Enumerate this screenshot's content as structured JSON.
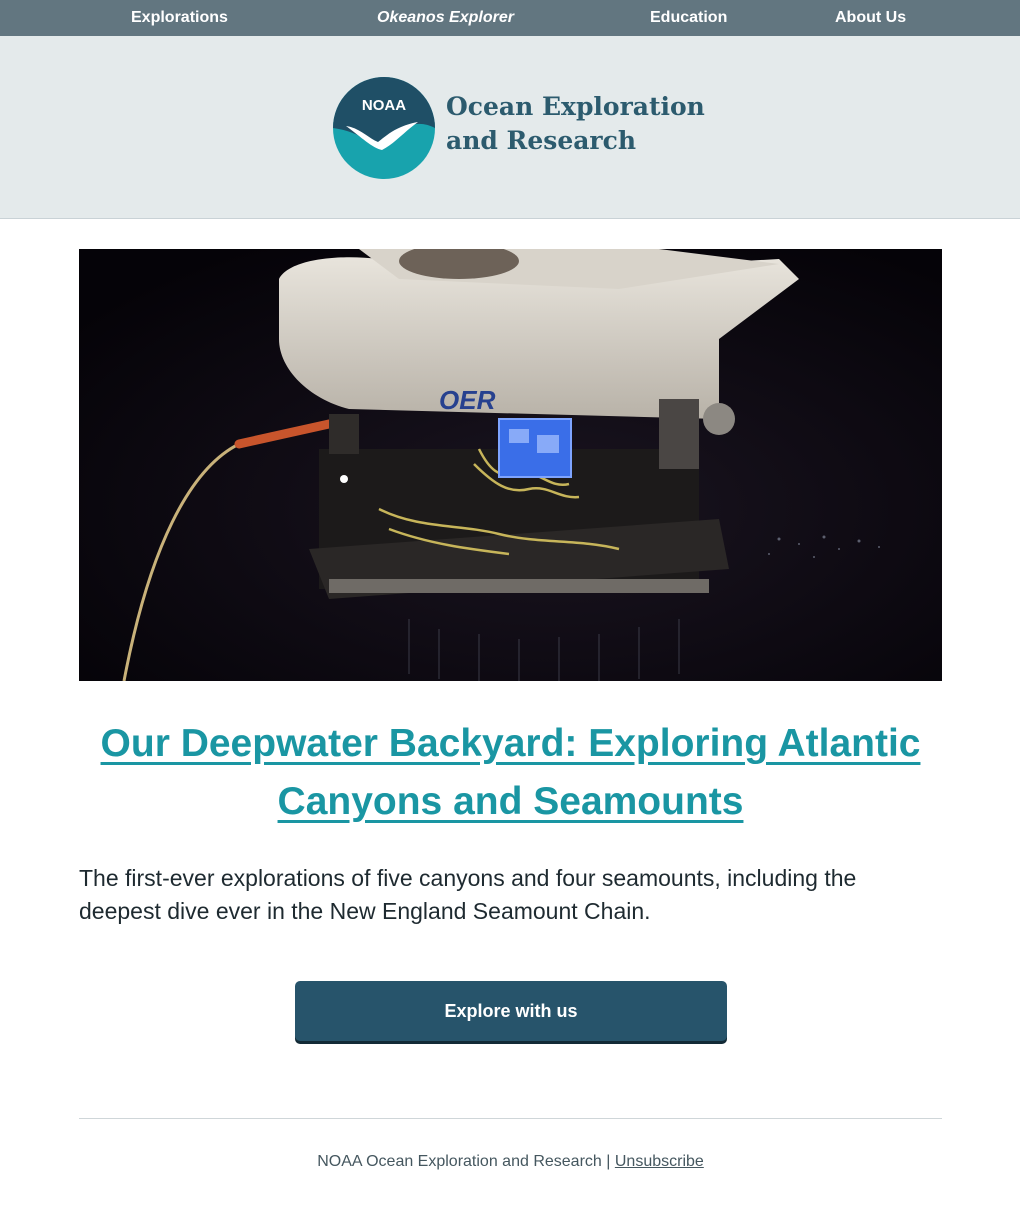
{
  "nav": {
    "items": [
      {
        "label": "Explorations"
      },
      {
        "label": "Okeanos Explorer"
      },
      {
        "label": "Education"
      },
      {
        "label": "About Us"
      }
    ]
  },
  "brand": {
    "logo_text": "NOAA",
    "name_line1": "Ocean Exploration",
    "name_line2": "and Research"
  },
  "hero": {
    "logo_text": "OER"
  },
  "article": {
    "title": "Our Deepwater Backyard: Exploring Atlantic Canyons and Seamounts",
    "summary": "The first-ever explorations of five canyons and four seamounts, including the deepest dive ever in the New England Seamount Chain."
  },
  "cta": {
    "label": "Explore with us"
  },
  "footer": {
    "org": "NOAA Ocean Exploration and Research",
    "separator": "|",
    "unsubscribe": "Unsubscribe"
  },
  "colors": {
    "nav_bg": "#627680",
    "header_bg": "#e4eaeb",
    "brand_text": "#2c5b6e",
    "headline": "#1a96a3",
    "button": "#27546b"
  }
}
